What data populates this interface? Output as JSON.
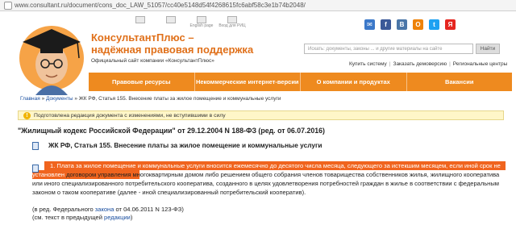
{
  "browser": {
    "url": "www.consultant.ru/document/cons_doc_LAW_51057/cc40e5148d54f4268615fc6abf58c3e1b74b2048/"
  },
  "header": {
    "title_line1": "КонсультантПлюс –",
    "title_line2": "надёжная правовая поддержка",
    "subtitle": "Официальный сайт компании «КонсультантПлюс»",
    "top_icons": [
      {
        "name": "home-icon",
        "caption": ""
      },
      {
        "name": "sitemap-icon",
        "caption": ""
      },
      {
        "name": "english-icon",
        "caption": "English page"
      },
      {
        "name": "login-icon",
        "caption": "Вход для РИЦ"
      }
    ],
    "social": [
      {
        "name": "mail-icon",
        "glyph": "✉",
        "color": "#3b78c9"
      },
      {
        "name": "facebook-icon",
        "glyph": "f",
        "color": "#3b5998"
      },
      {
        "name": "vk-icon",
        "glyph": "В",
        "color": "#4a76a8"
      },
      {
        "name": "odnoklassniki-icon",
        "glyph": "О",
        "color": "#ee8208"
      },
      {
        "name": "twitter-icon",
        "glyph": "t",
        "color": "#1da1f2"
      },
      {
        "name": "yandex-icon",
        "glyph": "Я",
        "color": "#e52620"
      }
    ],
    "search_placeholder": "Искать: документы, законы ... и другие материалы на сайте",
    "search_button": "Найти",
    "links": [
      "Купить систему",
      "Заказать демоверсию",
      "Региональные центры"
    ],
    "nav": [
      "Правовые ресурсы",
      "Некоммерческие интернет-версии",
      "О компании и продуктах",
      "Вакансии"
    ]
  },
  "breadcrumb": {
    "home": "Главная",
    "docs": "Документы",
    "current": "ЖК РФ, Статья 155. Внесение платы за жилое помещение и коммунальные услуги"
  },
  "notice": "Подготовлена редакция документа с изменениями, не вступившими в силу",
  "doc_title": "\"Жилищный кодекс Российской Федерации\" от 29.12.2004 N 188-ФЗ (ред. от 06.07.2016)",
  "doc_subtitle": "ЖК РФ, Статья 155. Внесение платы за жилое помещение и коммунальные услуги",
  "article": {
    "highlighted": "1. Плата за жилое помещение и коммунальные услуги вносится ежемесячно до десятого числа месяца, следующего за истекшим месяцем, если иной срок не установлен",
    "rest": " договором управления многоквартирным домом либо решением общего собрания членов товарищества собственников жилья, жилищного кооператива или иного специализированного потребительского кооператива, созданного в целях удовлетворения потребностей граждан в жилье в соответствии с федеральным законом о таком кооперативе (далее - иной специализированный потребительский кооператив).",
    "edit_prefix": "(в ред. Федерального ",
    "edit_link": "закона",
    "edit_suffix": " от 04.06.2011 N 123-ФЗ)",
    "prev_prefix": "(см. текст в предыдущей ",
    "prev_link": "редакции",
    "prev_suffix": ")"
  }
}
